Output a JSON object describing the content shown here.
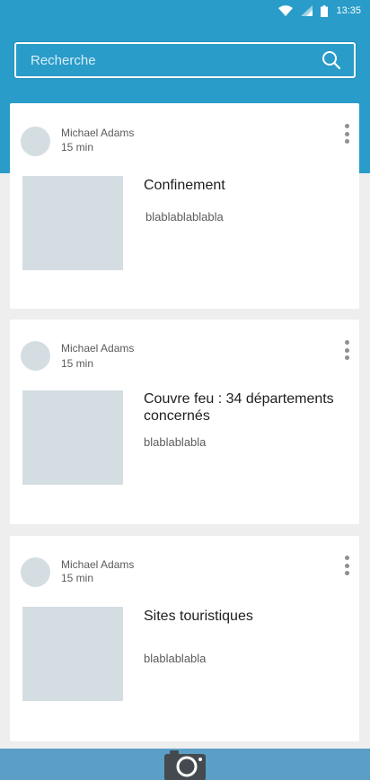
{
  "status_bar": {
    "time": "13:35",
    "icons": [
      "wifi-icon",
      "signal-icon",
      "battery-icon"
    ]
  },
  "search": {
    "placeholder": "Recherche",
    "icon": "search-icon"
  },
  "posts": [
    {
      "author": "Michael Adams",
      "time": "15 min",
      "title": "Confinement",
      "excerpt": "blablablablabla"
    },
    {
      "author": "Michael Adams",
      "time": "15 min",
      "title": "Couvre feu : 34 départements concernés",
      "excerpt": "blablablabla"
    },
    {
      "author": "Michael Adams",
      "time": "15 min",
      "title": "Sites touristiques",
      "excerpt": "blablablabla"
    }
  ],
  "bottom_bar": {
    "icon": "camera-icon"
  },
  "colors": {
    "header": "#2a9cc9",
    "bottom_bar": "#5b9fc6",
    "placeholder_gray": "#d4dde2",
    "background": "#eeeeee"
  }
}
